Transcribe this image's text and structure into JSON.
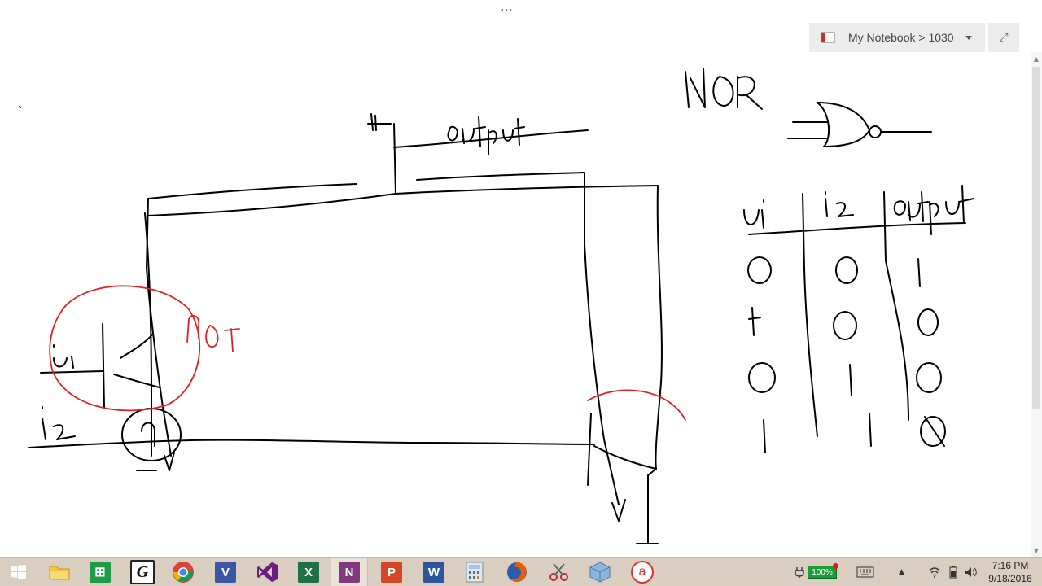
{
  "window": {
    "top_ellipsis": "...",
    "notebook_label": "My Notebook > 1030",
    "fullscreen_glyph": "⤢"
  },
  "drawing": {
    "title_text": "NOR",
    "output_label": "output",
    "not_label": "not",
    "input_1_label": "ui",
    "input_2_label": "iz",
    "table_headers": [
      "ui",
      "iz",
      "output"
    ],
    "table_rows": [
      [
        "0",
        "0",
        "1"
      ],
      [
        "1",
        "0",
        "0"
      ],
      [
        "0",
        "1",
        "0"
      ],
      [
        "1",
        "1",
        "0"
      ]
    ],
    "ink_colors": {
      "black": "#000000",
      "red": "#e02020"
    }
  },
  "taskbar": {
    "apps": [
      {
        "name": "start-button",
        "icon": "windows-logo-icon",
        "label": ""
      },
      {
        "name": "file-explorer",
        "icon": "folder-icon",
        "label": ""
      },
      {
        "name": "store",
        "icon": "store-bag-icon",
        "label": ""
      },
      {
        "name": "g-app",
        "icon": "g-icon",
        "label": "G"
      },
      {
        "name": "chrome",
        "icon": "chrome-icon",
        "label": ""
      },
      {
        "name": "visio",
        "icon": "visio-icon",
        "label": "V"
      },
      {
        "name": "visual-studio",
        "icon": "visual-studio-icon",
        "label": ""
      },
      {
        "name": "excel",
        "icon": "excel-icon",
        "label": "X"
      },
      {
        "name": "onenote",
        "icon": "onenote-icon",
        "label": "N"
      },
      {
        "name": "powerpoint",
        "icon": "powerpoint-icon",
        "label": "P"
      },
      {
        "name": "word",
        "icon": "word-icon",
        "label": "W"
      },
      {
        "name": "calculator",
        "icon": "calculator-icon",
        "label": ""
      },
      {
        "name": "firefox",
        "icon": "firefox-icon",
        "label": ""
      },
      {
        "name": "snipping-tool",
        "icon": "scissors-icon",
        "label": ""
      },
      {
        "name": "virtualbox",
        "icon": "cube-icon",
        "label": ""
      },
      {
        "name": "a-app",
        "icon": "a-circle-icon",
        "label": "a"
      }
    ],
    "battery_label": "100%",
    "clock_time": "7:16 PM",
    "clock_date": "9/18/2016",
    "colors": {
      "taskbar_bg": "#d9cec0",
      "excel_green": "#1e7145",
      "onenote_purple": "#80397b",
      "powerpoint_red": "#d24726",
      "word_blue": "#2b579a",
      "visio_blue": "#3955a3",
      "vs_purple": "#68217a"
    }
  }
}
